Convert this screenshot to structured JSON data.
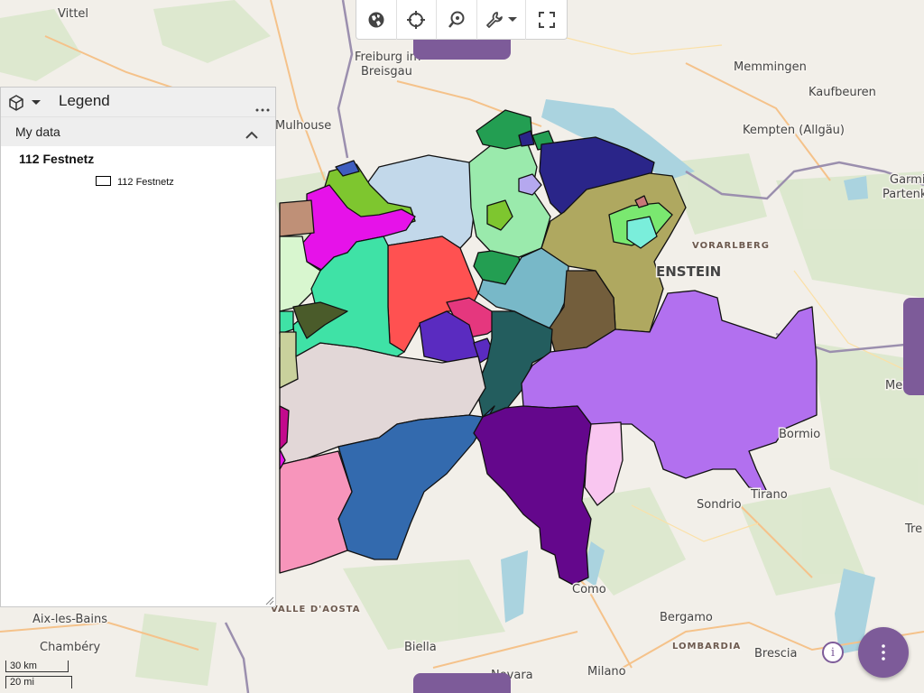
{
  "toolbar": {
    "buttons": [
      {
        "icon": "globe-icon"
      },
      {
        "icon": "crosshair-icon"
      },
      {
        "icon": "location-search-icon"
      },
      {
        "icon": "wrench-icon",
        "has_dropdown": true
      },
      {
        "icon": "fullscreen-icon"
      }
    ]
  },
  "legend": {
    "title": "Legend",
    "section_label": "My data",
    "layer_name": "112 Festnetz",
    "items": [
      {
        "label": "112 Festnetz",
        "fill": "#ffffff",
        "stroke": "#000000"
      }
    ]
  },
  "map": {
    "places": [
      "Vittel",
      "Freiburg im",
      "Breisgau",
      "Memmingen",
      "Kaufbeuren",
      "Mulhouse",
      "Kempten (Allgäu)",
      "Garmi",
      "Partenk",
      "Bormio",
      "Tirano",
      "Sondrio",
      "Meran",
      "Como",
      "Bergamo",
      "Brescia",
      "Milano",
      "Biella",
      "Novara",
      "Aix-les-Bains",
      "Chambéry",
      "Tre"
    ],
    "regions": [
      "VORARLBERG",
      "VALLE D'AOSTA",
      "LOMBARDIA"
    ],
    "country_fragment": "ENSTEIN",
    "ch_colors": [
      "#bf9077",
      "#3fe2a6",
      "#7ec62f",
      "#e612e9",
      "#c2d8ea",
      "#9aeaac",
      "#239e52",
      "#ff5151",
      "#e5377e",
      "#2a2589",
      "#afa860",
      "#735e3c",
      "#78b8c8",
      "#235d5e",
      "#b270ef",
      "#e2d7d7",
      "#336aae",
      "#64078c",
      "#f795bb",
      "#c9d19c",
      "#d8f6cf"
    ]
  },
  "scale": {
    "metric": "30 km",
    "imperial": "20 mi"
  },
  "info_label": "i",
  "accent": "#7d5b99"
}
